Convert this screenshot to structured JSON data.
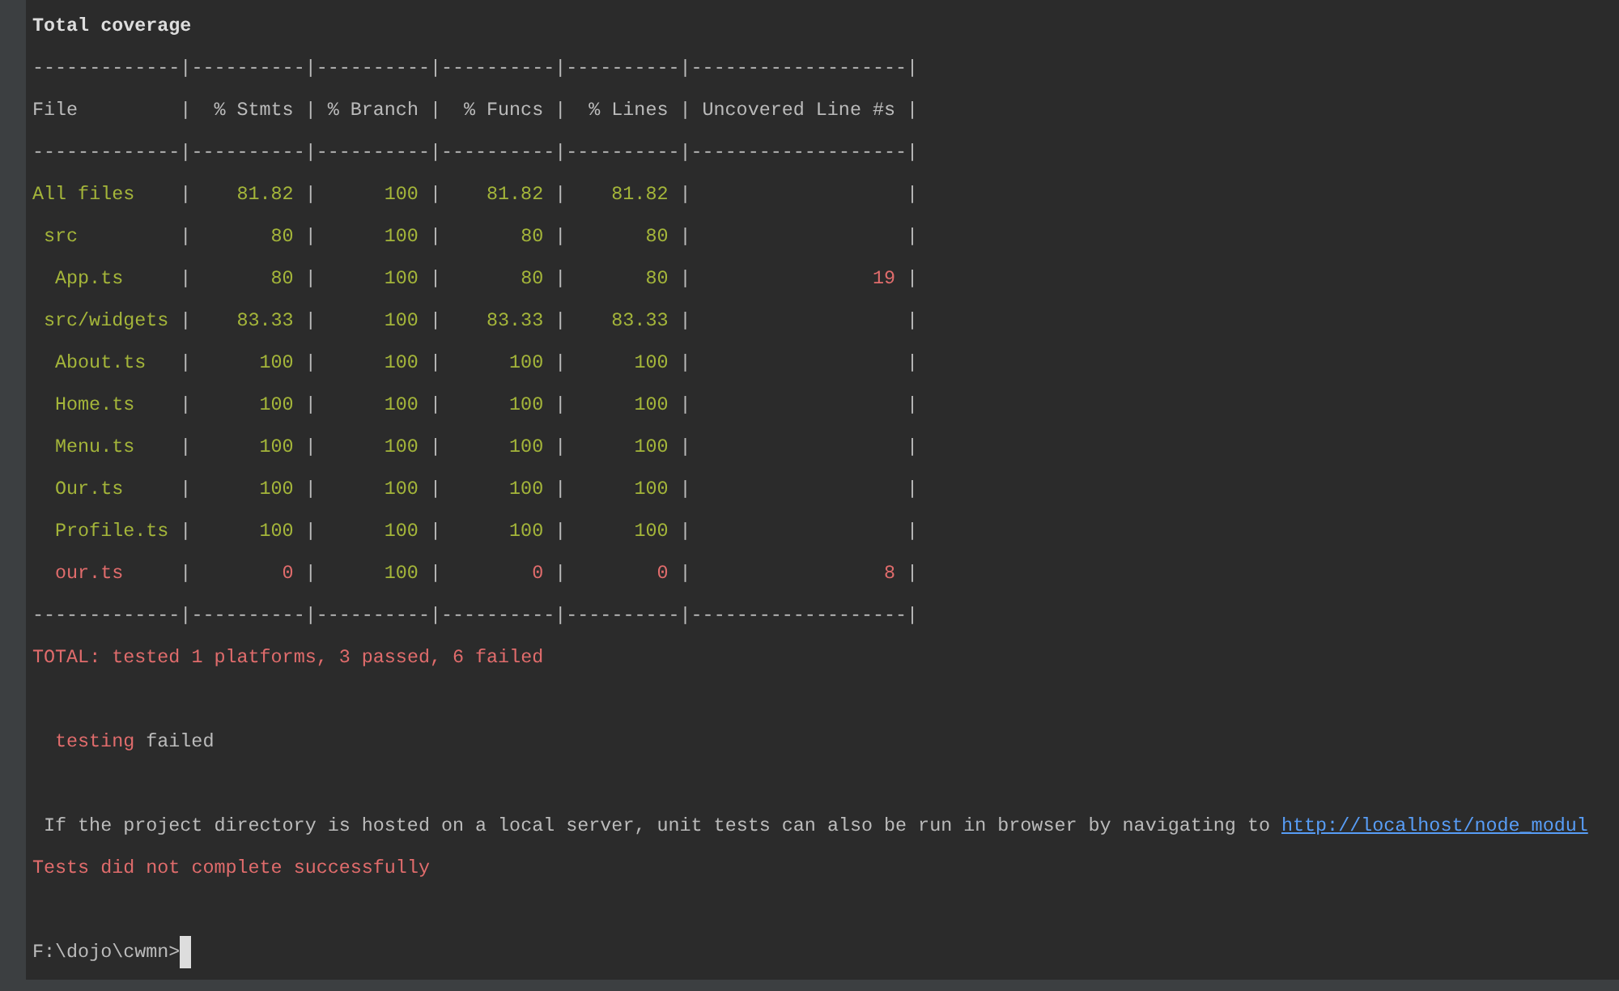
{
  "title": "Total coverage",
  "separator": "-------------|----------|----------|----------|----------|-------------------|",
  "column_divider": "|",
  "columns": [
    "File",
    "% Stmts",
    "% Branch",
    "% Funcs",
    "% Lines",
    "Uncovered Line #s"
  ],
  "rows": [
    {
      "file": "All files",
      "covered": true,
      "values": [
        "81.82",
        "100",
        "81.82",
        "81.82"
      ],
      "children": [
        {
          "file": "src",
          "covered": true,
          "values": [
            "80",
            "100",
            "80",
            "80"
          ],
          "children": [
            {
              "file": "App.ts",
              "covered": true,
              "values": [
                "80",
                "100",
                "80",
                "80"
              ],
              "uncovered": "19"
            }
          ]
        },
        {
          "file": "src/widgets",
          "covered": true,
          "values": [
            "83.33",
            "100",
            "83.33",
            "83.33"
          ],
          "children": [
            {
              "file": "About.ts",
              "covered": true,
              "values": [
                "100",
                "100",
                "100",
                "100"
              ]
            },
            {
              "file": "Home.ts",
              "covered": true,
              "values": [
                "100",
                "100",
                "100",
                "100"
              ]
            },
            {
              "file": "Menu.ts",
              "covered": true,
              "values": [
                "100",
                "100",
                "100",
                "100"
              ]
            },
            {
              "file": "Our.ts",
              "covered": true,
              "values": [
                "100",
                "100",
                "100",
                "100"
              ]
            },
            {
              "file": "Profile.ts",
              "covered": true,
              "values": [
                "100",
                "100",
                "100",
                "100"
              ]
            },
            {
              "file": "our.ts",
              "covered": false,
              "values": [
                "0",
                "100",
                "0",
                "0"
              ],
              "uncovered": "8"
            }
          ]
        }
      ]
    }
  ],
  "total_line": "TOTAL: tested 1 platforms, 3 passed, 6 failed",
  "task_status": {
    "name": "testing",
    "result": "failed"
  },
  "hint": {
    "text": "If the project directory is hosted on a local server, unit tests can also be run in browser by navigating to ",
    "link": "http://localhost/node_modul"
  },
  "error_line": "Tests did not complete successfully",
  "prompt": "F:\\dojo\\cwmn>"
}
